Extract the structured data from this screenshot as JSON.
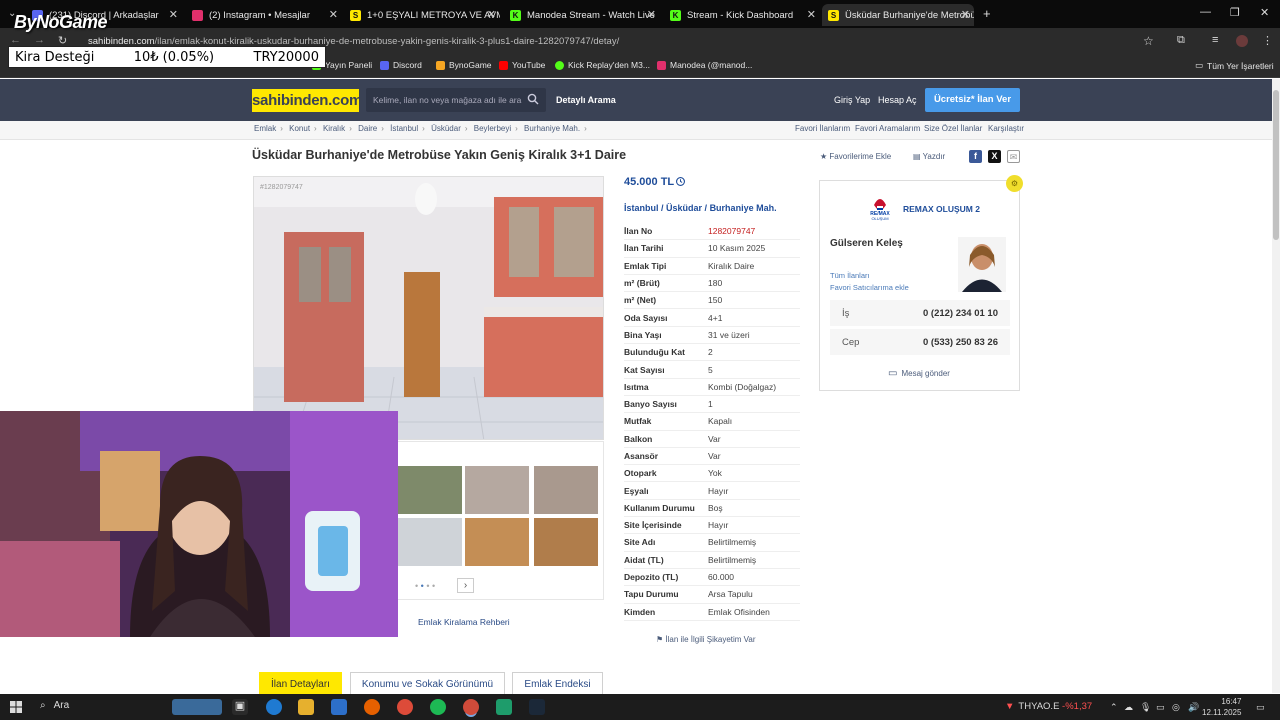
{
  "browser": {
    "tabs": [
      {
        "label": "(231) Discord | Arkadaşlar",
        "color": "#5865f2"
      },
      {
        "label": "(2) Instagram • Mesajlar",
        "color": "#e1306c"
      },
      {
        "label": "1+0 EŞYALI METROYA VE AVM",
        "color": "#ffe800"
      },
      {
        "label": "Manodea Stream - Watch Live",
        "color": "#53fc18"
      },
      {
        "label": "Stream - Kick Dashboard",
        "color": "#53fc18"
      },
      {
        "label": "Üsküdar Burhaniye'de Metrobü",
        "color": "#ffe800"
      }
    ],
    "new_tab": "+",
    "url_domain": "sahibinden.com",
    "url_path": "/ilan/emlak-konut-kiralik-uskudar-burhaniye-de-metrobuse-yakin-genis-kiralik-3-plus1-daire-1282079747/detay/",
    "bookmarks": [
      "Yayın Paneli",
      "Discord",
      "BynoGame",
      "YouTube",
      "Kick Replay'den M3...",
      "Manodea (@manod..."
    ],
    "all_bookmarks": "Tüm Yer İşaretleri"
  },
  "overlay": {
    "brand": "ByNoGame",
    "kira_label": "Kira Desteği",
    "kira_amount": "10₺ (0.05%)",
    "kira_target": "TRY20000"
  },
  "site": {
    "logo": "sahibinden.com",
    "search_placeholder": "Kelime, ilan no veya mağaza adı ile ara",
    "advanced_search": "Detaylı Arama",
    "login": "Giriş Yap",
    "register": "Hesap Aç",
    "post_ad": "Ücretsiz* İlan Ver",
    "breadcrumbs": [
      "Emlak",
      "Konut",
      "Kiralık",
      "Daire",
      "İstanbul",
      "Üsküdar",
      "Beylerbeyi",
      "Burhaniye Mah."
    ],
    "right_links": [
      "Favori İlanlarım",
      "Favori Aramalarım",
      "Size Özel İlanlar",
      "Karşılaştır"
    ]
  },
  "listing": {
    "title": "Üsküdar Burhaniye'de Metrobüse Yakın Geniş Kiralık 3+1 Daire",
    "favorite": "Favorilerime Ekle",
    "print": "Yazdır",
    "photo_id": "#1282079747",
    "price": "45.000 TL",
    "location": [
      "İstanbul",
      "Üsküdar",
      "Burhaniye Mah."
    ],
    "details": [
      {
        "label": "İlan No",
        "value": "1282079747",
        "highlight": true
      },
      {
        "label": "İlan Tarihi",
        "value": "10 Kasım 2025"
      },
      {
        "label": "Emlak Tipi",
        "value": "Kiralık Daire"
      },
      {
        "label": "m² (Brüt)",
        "value": "180"
      },
      {
        "label": "m² (Net)",
        "value": "150"
      },
      {
        "label": "Oda Sayısı",
        "value": "4+1"
      },
      {
        "label": "Bina Yaşı",
        "value": "31 ve üzeri"
      },
      {
        "label": "Bulunduğu Kat",
        "value": "2"
      },
      {
        "label": "Kat Sayısı",
        "value": "5"
      },
      {
        "label": "Isıtma",
        "value": "Kombi (Doğalgaz)"
      },
      {
        "label": "Banyo Sayısı",
        "value": "1"
      },
      {
        "label": "Mutfak",
        "value": "Kapalı"
      },
      {
        "label": "Balkon",
        "value": "Var"
      },
      {
        "label": "Asansör",
        "value": "Var"
      },
      {
        "label": "Otopark",
        "value": "Yok"
      },
      {
        "label": "Eşyalı",
        "value": "Hayır"
      },
      {
        "label": "Kullanım Durumu",
        "value": "Boş"
      },
      {
        "label": "Site İçerisinde",
        "value": "Hayır"
      },
      {
        "label": "Site Adı",
        "value": "Belirtilmemiş"
      },
      {
        "label": "Aidat (TL)",
        "value": "Belirtilmemiş"
      },
      {
        "label": "Depozito (TL)",
        "value": "60.000"
      },
      {
        "label": "Tapu Durumu",
        "value": "Arsa Tapulu"
      },
      {
        "label": "Kimden",
        "value": "Emlak Ofisinden"
      }
    ],
    "complaint": "İlan ile İlgili Şikayetim Var",
    "rental_guide": "Emlak Kiralama Rehberi"
  },
  "seller": {
    "agency": "REMAX OLUŞUM 2",
    "remax_logo_text": "RE/MAX",
    "remax_logo_sub": "OLUŞUM",
    "agent": "Gülseren Keleş",
    "all_ads": "Tüm İlanları",
    "add_fav_seller": "Favori Satıcılarıma ekle",
    "phones": [
      {
        "label": "İş",
        "value": "0 (212) 234 01 10"
      },
      {
        "label": "Cep",
        "value": "0 (533) 250 83 26"
      }
    ],
    "message": "Mesaj gönder"
  },
  "bottom_tabs": [
    "İlan Detayları",
    "Konumu ve Sokak Görünümü",
    "Emlak Endeksi"
  ],
  "taskbar": {
    "search": "Ara",
    "ticker_symbol": "THYAO.E",
    "ticker_change": "-%1,37",
    "time": "16:47",
    "date": "12.11.2025"
  }
}
